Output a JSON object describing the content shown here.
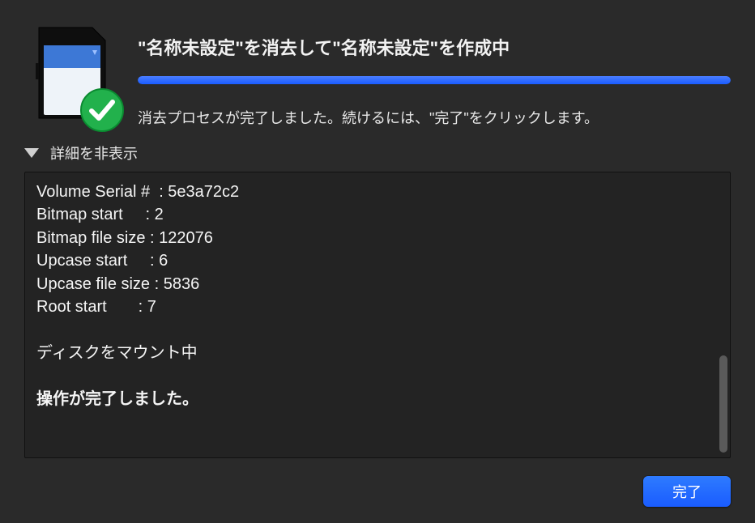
{
  "header": {
    "title": "\"名称未設定\"を消去して\"名称未設定\"を作成中",
    "status": "消去プロセスが完了しました。続けるには、\"完了\"をクリックします。",
    "progress_percent": 100
  },
  "disclosure": {
    "label": "詳細を非表示"
  },
  "log": {
    "lines": [
      "Volume Serial #  : 5e3a72c2",
      "Bitmap start     : 2",
      "Bitmap file size : 122076",
      "Upcase start     : 6",
      "Upcase file size : 5836",
      "Root start       : 7",
      "",
      "ディスクをマウント中",
      "",
      "操作が完了しました。"
    ],
    "bold_last": true
  },
  "footer": {
    "done_label": "完了"
  }
}
